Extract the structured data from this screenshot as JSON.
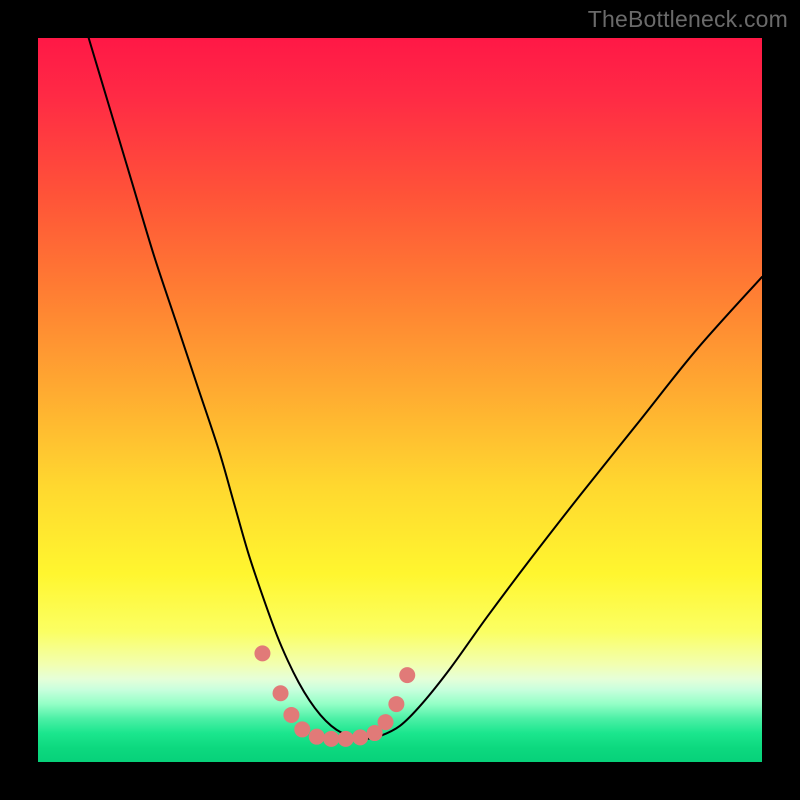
{
  "watermark": "TheBottleneck.com",
  "chart_data": {
    "type": "line",
    "title": "",
    "xlabel": "",
    "ylabel": "",
    "xlim": [
      0,
      100
    ],
    "ylim": [
      0,
      100
    ],
    "grid": false,
    "legend": false,
    "curve": {
      "name": "bottleneck-curve",
      "color": "#000000",
      "stroke_width": 2,
      "x": [
        7,
        10,
        13,
        16,
        19,
        22,
        25,
        27,
        29,
        31,
        33,
        34.5,
        36,
        37.5,
        39,
        40.5,
        42,
        43.5,
        45,
        47,
        50,
        53,
        57,
        62,
        68,
        75,
        83,
        91,
        100
      ],
      "y": [
        100,
        90,
        80,
        70,
        61,
        52,
        43,
        36,
        29,
        23,
        17.5,
        14,
        11,
        8.5,
        6.5,
        5,
        4,
        3.4,
        3.2,
        3.5,
        5,
        8,
        13,
        20,
        28,
        37,
        47,
        57,
        67
      ]
    },
    "markers": {
      "name": "highlight-dots",
      "color": "#e17a78",
      "radius": 8,
      "points": [
        {
          "x": 31.0,
          "y": 15.0
        },
        {
          "x": 33.5,
          "y": 9.5
        },
        {
          "x": 35.0,
          "y": 6.5
        },
        {
          "x": 36.5,
          "y": 4.5
        },
        {
          "x": 38.5,
          "y": 3.5
        },
        {
          "x": 40.5,
          "y": 3.2
        },
        {
          "x": 42.5,
          "y": 3.2
        },
        {
          "x": 44.5,
          "y": 3.4
        },
        {
          "x": 46.5,
          "y": 4.0
        },
        {
          "x": 48.0,
          "y": 5.5
        },
        {
          "x": 49.5,
          "y": 8.0
        },
        {
          "x": 51.0,
          "y": 12.0
        }
      ]
    }
  }
}
